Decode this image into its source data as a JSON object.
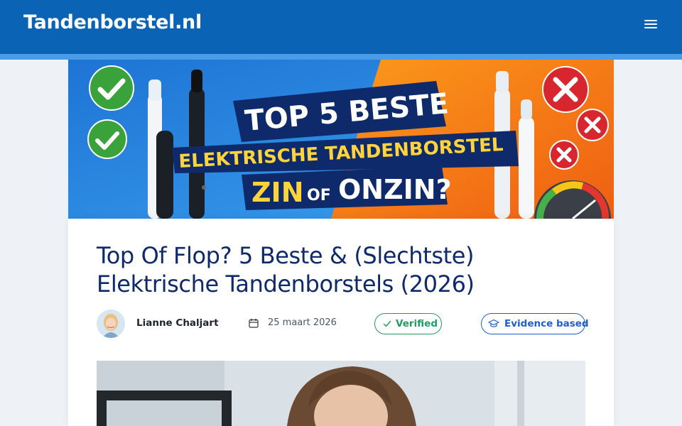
{
  "header": {
    "logo_text": "Tandenborstel.nl",
    "menu_icon": "hamburger-menu-icon",
    "background_color": "#0b63b5",
    "stripe_color": "#4a9be8"
  },
  "hero": {
    "line1": "TOP 5 BESTE",
    "line2": "ELEKTRISCHE TANDENBORSTEL",
    "line3_a": "ZIN",
    "line3_b": "OF",
    "line3_c": "ONZIN?",
    "left_color": "#2f8fe6",
    "right_color": "#f47b14"
  },
  "article": {
    "title_line1": "Top Of Flop? 5 Beste & (Slechtste)",
    "title_line2": "Elektrische Tandenborstels (2026)",
    "author": "Lianne Chaljart",
    "date": "25 maart 2026",
    "verified_label": "Verified",
    "evidence_label": "Evidence based",
    "title_color": "#0f2a6b",
    "verified_color": "#1e9e63",
    "evidence_color": "#1f5fcf"
  }
}
